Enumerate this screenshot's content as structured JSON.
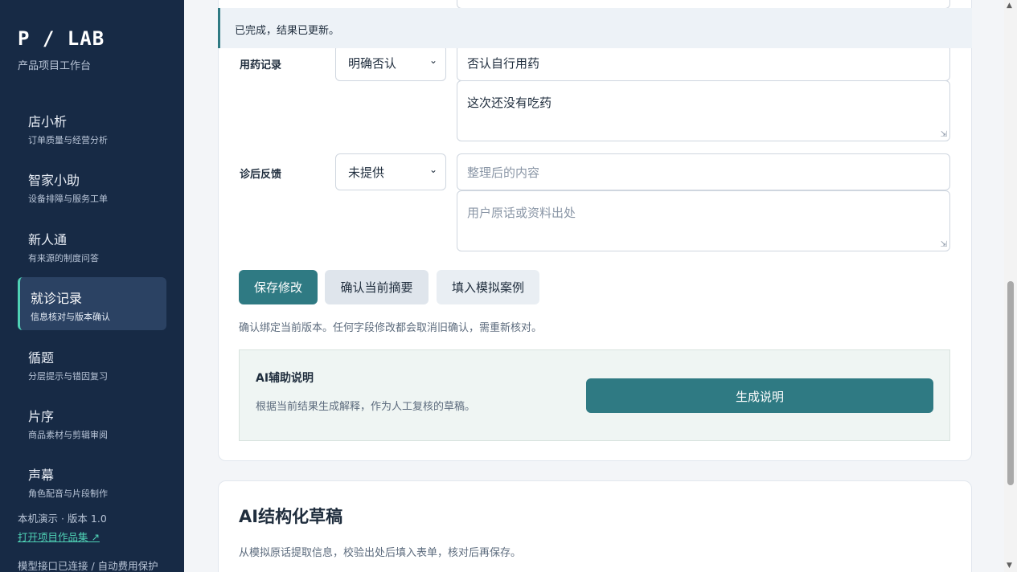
{
  "sidebar": {
    "brand": "P / LAB",
    "brand_sub": "产品项目工作台",
    "items": [
      {
        "title": "店小析",
        "sub": "订单质量与经营分析"
      },
      {
        "title": "智家小助",
        "sub": "设备排障与服务工单"
      },
      {
        "title": "新人通",
        "sub": "有来源的制度问答"
      },
      {
        "title": "就诊记录",
        "sub": "信息核对与版本确认"
      },
      {
        "title": "循题",
        "sub": "分层提示与错因复习"
      },
      {
        "title": "片序",
        "sub": "商品素材与剪辑审阅"
      },
      {
        "title": "声幕",
        "sub": "角色配音与片段制作"
      }
    ],
    "footer_version": "本机演示 · 版本 1.0",
    "footer_link": "打开项目作品集 ↗",
    "footer_status": "模型接口已连接 / 自动费用保护"
  },
  "toast": "已完成，结果已更新。",
  "form": {
    "medication": {
      "label": "用药记录",
      "select": "明确否认",
      "input": "否认自行用药",
      "textarea": "这次还没有吃药"
    },
    "feedback": {
      "label": "诊后反馈",
      "select": "未提供",
      "input_placeholder": "整理后的内容",
      "textarea_placeholder": "用户原话或资料出处"
    },
    "buttons": {
      "save": "保存修改",
      "confirm": "确认当前摘要",
      "fill": "填入模拟案例"
    },
    "note": "确认绑定当前版本。任何字段修改都会取消旧确认，需重新核对。"
  },
  "ai_box": {
    "title": "AI辅助说明",
    "desc": "根据当前结果生成解释，作为人工复核的草稿。",
    "button": "生成说明"
  },
  "draft": {
    "title": "AI结构化草稿",
    "desc": "从模拟原话提取信息，校验出处后填入表单，核对后再保存。"
  },
  "colors": {
    "sidebar_bg": "#172a45",
    "accent": "#2f7a83",
    "active_border": "#4fd1b5"
  }
}
